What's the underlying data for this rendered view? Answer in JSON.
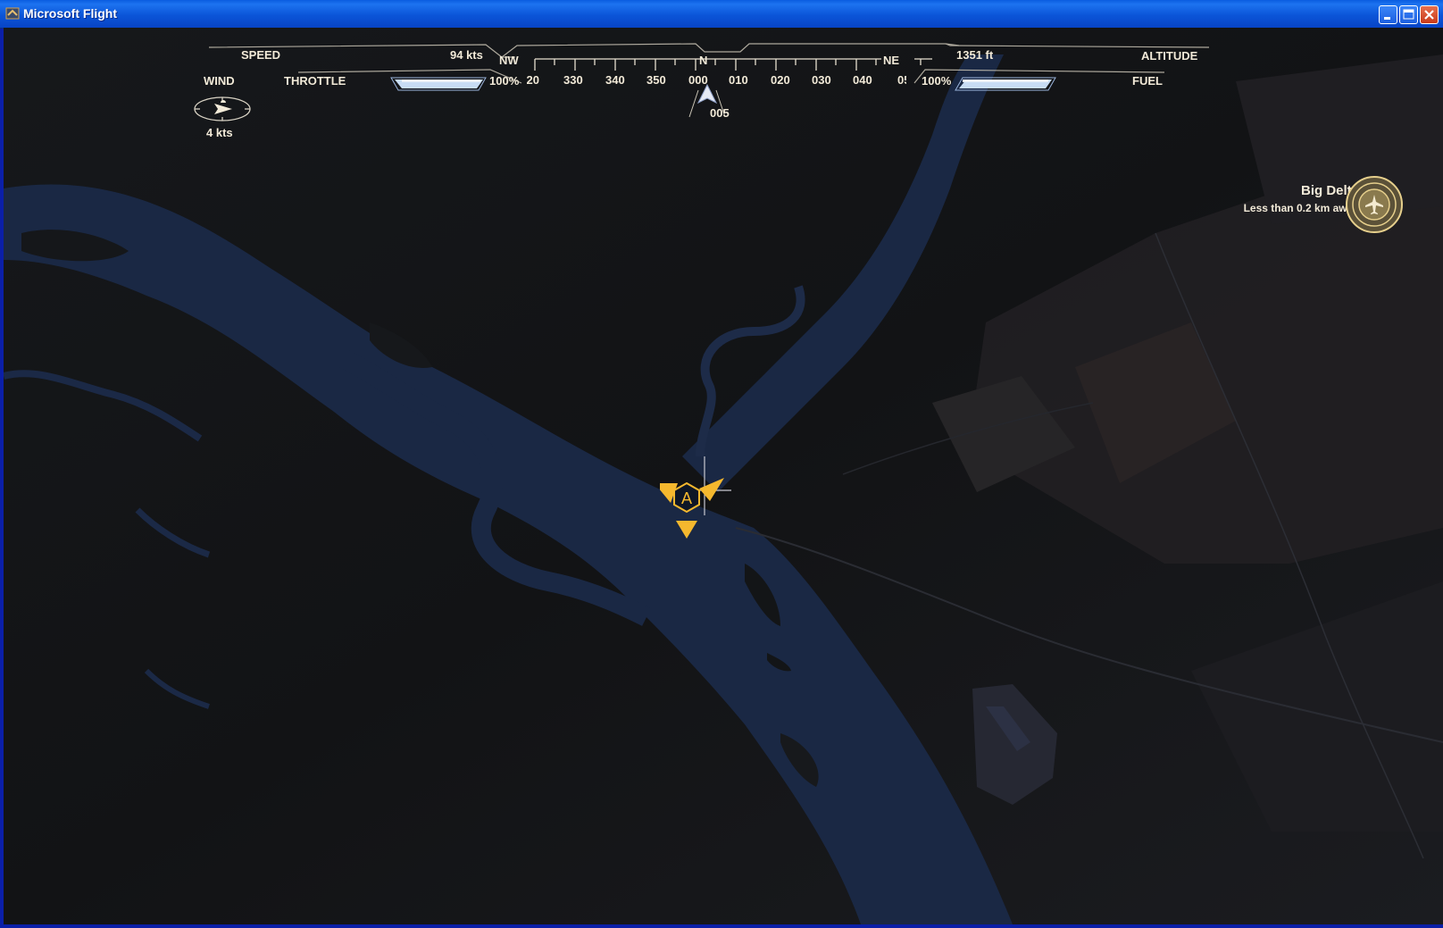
{
  "window": {
    "title": "Microsoft Flight",
    "controls": [
      "minimize",
      "maximize",
      "close"
    ]
  },
  "hud": {
    "speed_label": "SPEED",
    "speed_value": "94 kts",
    "throttle_label": "THROTTLE",
    "throttle_value": "100%",
    "throttle_level": 1.0,
    "wind_label": "WIND",
    "wind_value": "4  kts",
    "altitude_label": "ALTITUDE",
    "altitude_value": "1351 ft",
    "fuel_label": "FUEL",
    "fuel_value": "100%",
    "fuel_level": 1.0
  },
  "compass": {
    "cardinals": [
      "NW",
      "N",
      "NE"
    ],
    "ticks": [
      "320",
      "330",
      "340",
      "350",
      "000",
      "010",
      "020",
      "030",
      "040",
      "050"
    ],
    "heading": "005"
  },
  "destination": {
    "name": "Big Delta",
    "distance": "Less than 0.2 km away",
    "icon": "airport-icon"
  },
  "marker": {
    "letter": "A",
    "color": "#f5b82e"
  },
  "colors": {
    "hud_text": "#f2ead8",
    "water": "#1a2a45",
    "land": "#15171a",
    "marker": "#f5b82e"
  }
}
